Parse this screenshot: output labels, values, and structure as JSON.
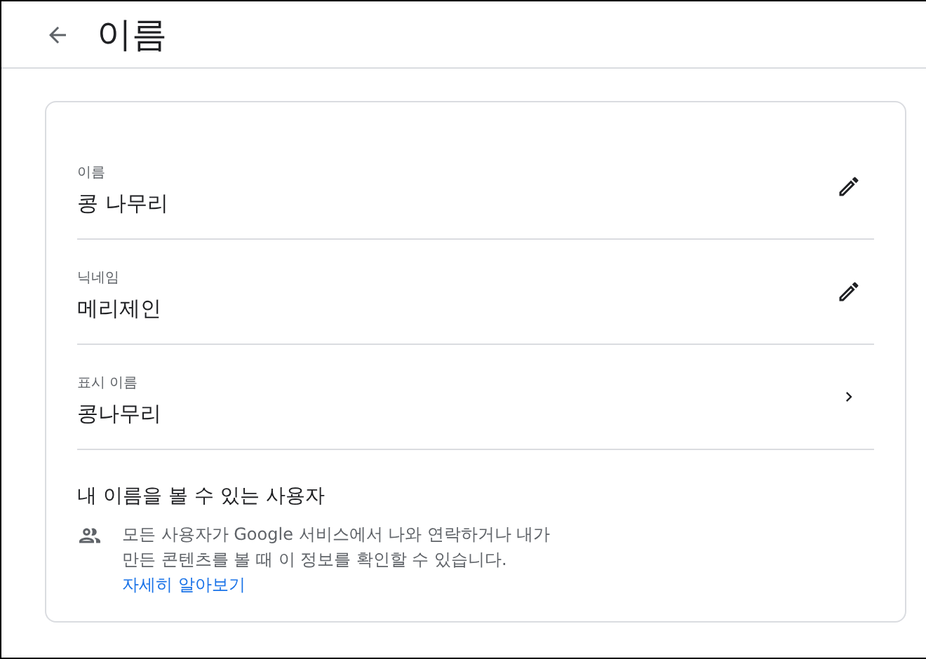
{
  "header": {
    "title": "이름"
  },
  "fields": [
    {
      "label": "이름",
      "value": "콩 나무리",
      "kind": "edit"
    },
    {
      "label": "닉네임",
      "value": "메리제인",
      "kind": "edit"
    },
    {
      "label": "표시 이름",
      "value": "콩나무리",
      "kind": "navigate"
    }
  ],
  "visibility": {
    "title": "내 이름을 볼 수 있는 사용자",
    "lines": [
      "모든 사용자가 Google 서비스에서 나와 연락하거나 내가",
      "만든 콘텐츠를 볼 때 이 정보를 확인할 수 있습니다."
    ],
    "link": "자세히 알아보기"
  }
}
